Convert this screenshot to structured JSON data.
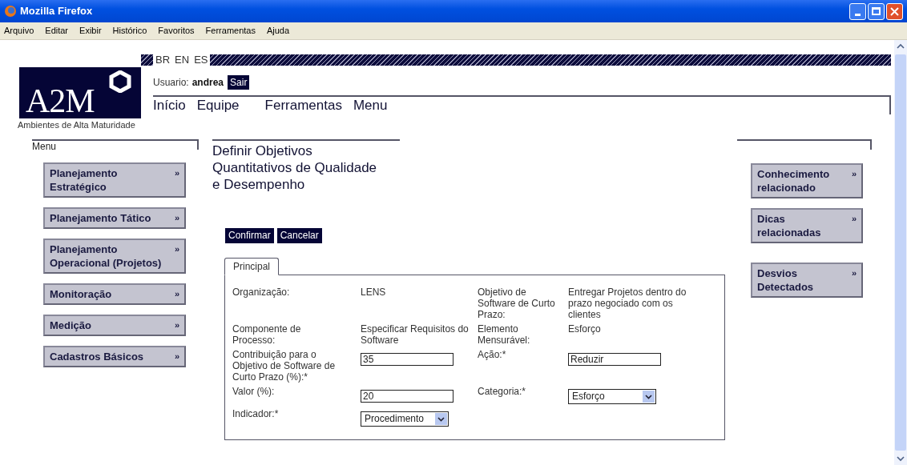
{
  "window": {
    "title": "Mozilla Firefox"
  },
  "menu_bar": [
    "Arquivo",
    "Editar",
    "Exibir",
    "Histórico",
    "Favoritos",
    "Ferramentas",
    "Ajuda"
  ],
  "languages": [
    "BR",
    "EN",
    "ES"
  ],
  "logo": {
    "text": "A2M",
    "tagline": "Ambientes de Alta Maturidade"
  },
  "user": {
    "label": "Usuario:",
    "name": "andrea",
    "logout": "Sair"
  },
  "nav": [
    "Início",
    "Equipe",
    "Ferramentas",
    "Menu"
  ],
  "left_menu": {
    "title": "Menu",
    "items": [
      {
        "label": "Planejamento Estratégico",
        "arrow": "»"
      },
      {
        "label": "Planejamento Tático",
        "arrow": "»"
      },
      {
        "label": "Planejamento Operacional (Projetos)",
        "arrow": "»"
      },
      {
        "label": "Monitoração",
        "arrow": "»"
      },
      {
        "label": "Medição",
        "arrow": "»"
      },
      {
        "label": "Cadastros Básicos",
        "arrow": "»"
      }
    ]
  },
  "page_title": "Definir Objetivos Quantitativos de Qualidade e Desempenho",
  "actions": [
    "Confirmar",
    "Cancelar"
  ],
  "tabs": [
    {
      "label": "Principal",
      "selected": true
    }
  ],
  "form_rows": [
    [
      {
        "kind": "label",
        "text": "Organização:"
      },
      {
        "kind": "text",
        "text": "LENS"
      },
      {
        "kind": "label",
        "text": "Objetivo de Software de Curto Prazo:"
      },
      {
        "kind": "text",
        "text": "Entregar Projetos dentro do prazo negociado com os clientes"
      }
    ],
    [
      {
        "kind": "label",
        "text": "Componente de Processo:"
      },
      {
        "kind": "text",
        "text": "Especificar Requisitos do Software"
      },
      {
        "kind": "label",
        "text": "Elemento Mensurável:"
      },
      {
        "kind": "text",
        "text": "Esforço"
      }
    ],
    [
      {
        "kind": "label",
        "text": "Contribuição para o Objetivo de Software de Curto Prazo (%):*"
      },
      {
        "kind": "input",
        "text": "35"
      },
      {
        "kind": "label",
        "text": "Ação:*"
      },
      {
        "kind": "input",
        "text": "Reduzir"
      }
    ],
    [
      {
        "kind": "label",
        "text": "Valor (%):"
      },
      {
        "kind": "input",
        "text": "20"
      },
      {
        "kind": "label",
        "text": "Categoria:*"
      },
      {
        "kind": "select",
        "text": "Esforço"
      }
    ],
    [
      {
        "kind": "label",
        "text": "Indicador:*"
      },
      {
        "kind": "select",
        "text": "Procedimento"
      }
    ]
  ],
  "right_menu": [
    {
      "label": "Conhecimento relacionado",
      "arrow": "»"
    },
    {
      "label": "Dicas relacionadas",
      "arrow": "»"
    },
    {
      "label": "Desvios Detectados",
      "arrow": "»"
    }
  ]
}
